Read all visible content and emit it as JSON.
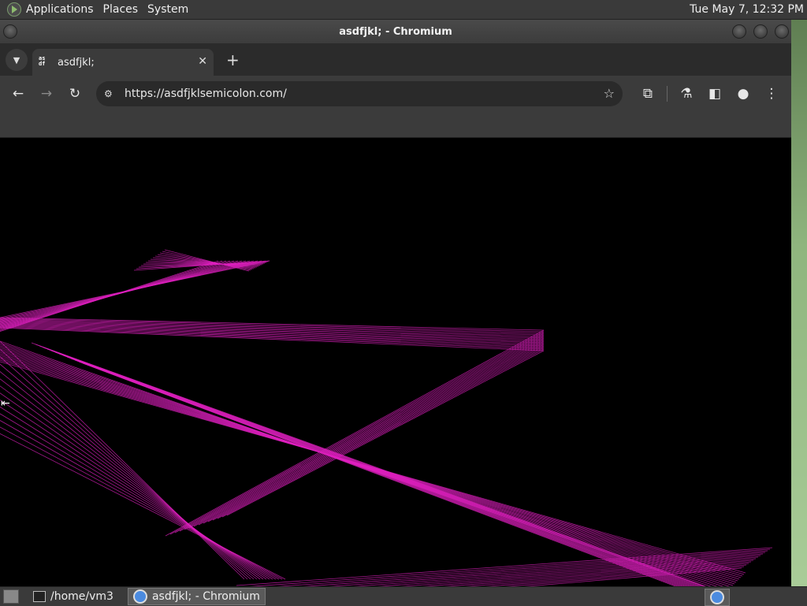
{
  "top_panel": {
    "menus": [
      "Applications",
      "Places",
      "System"
    ],
    "clock": "Tue May  7, 12:32 PM"
  },
  "window": {
    "title": "asdfjkl; - Chromium"
  },
  "tab": {
    "title": "asdfjkl;",
    "favicon_text": "as df"
  },
  "toolbar": {
    "url": "https://asdfjklsemicolon.com/",
    "icons": [
      "back-icon",
      "forward-icon",
      "reload-icon",
      "site-info-icon",
      "bookmark-star-icon",
      "extensions-icon",
      "labs-icon",
      "side-panel-icon",
      "profile-icon",
      "menu-icon"
    ]
  },
  "taskbar": {
    "tasks": [
      "/home/vm3",
      "asdfjkl; - Chromium"
    ]
  },
  "colors": {
    "line_color": "#e020c0",
    "panel": "#3a3a3a",
    "toolbar": "#3b3b3b"
  }
}
